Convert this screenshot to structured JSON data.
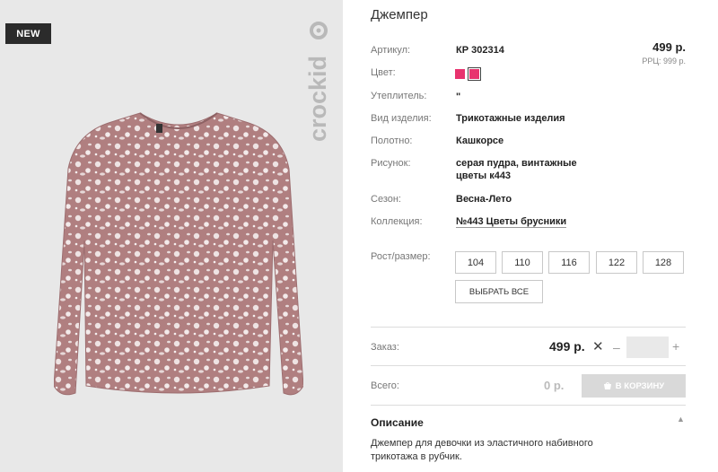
{
  "image_panel": {
    "badge": "NEW",
    "brand_logo_text": "crockid"
  },
  "product": {
    "title": "Джемпер",
    "price": "499 р.",
    "rrp": "РРЦ: 999 р."
  },
  "specs": {
    "article": {
      "label": "Артикул:",
      "value": "КР 302314"
    },
    "color": {
      "label": "Цвет:",
      "swatch_color": "#e8336e"
    },
    "insulation": {
      "label": "Утеплитель:",
      "value": "\""
    },
    "item_type": {
      "label": "Вид изделия:",
      "value": "Трикотажные изделия"
    },
    "fabric": {
      "label": "Полотно:",
      "value": "Кашкорсе"
    },
    "pattern": {
      "label": "Рисунок:",
      "line1": "серая пудра, винтажные",
      "line2": "цветы к443"
    },
    "season": {
      "label": "Сезон:",
      "value": "Весна-Лето"
    },
    "collection": {
      "label": "Коллекция:",
      "value": "№443 Цветы брусники"
    }
  },
  "sizes": {
    "label": "Рост/размер:",
    "options": [
      "104",
      "110",
      "116",
      "122",
      "128"
    ],
    "select_all": "ВЫБРАТЬ ВСЕ"
  },
  "order": {
    "label": "Заказ:",
    "price": "499 р.",
    "remove": "✕",
    "minus": "–",
    "plus": "+",
    "quantity": ""
  },
  "total": {
    "label": "Всего:",
    "value": "0 р.",
    "cart_button": "В КОРЗИНУ"
  },
  "description": {
    "heading": "Описание",
    "chevron": "▲",
    "text": "Джемпер для девочки из эластичного набивного трикотажа в рубчик."
  },
  "colors": {
    "accent_pink": "#e8336e",
    "shirt_base": "#b07f80",
    "photo_bg": "#e8e8e8",
    "cart_disabled": "#d9d9d9"
  }
}
